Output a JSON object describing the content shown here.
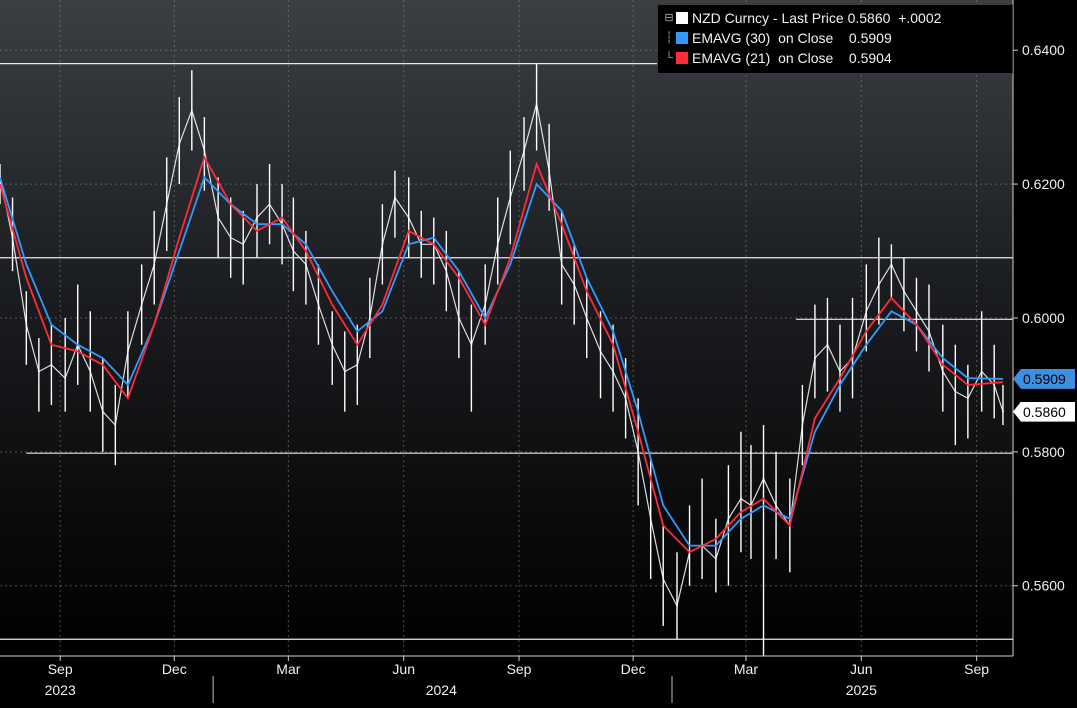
{
  "legend": {
    "row1": {
      "name": "NZD Curncy - Last Price",
      "value": "0.5860",
      "change": "+.0002",
      "color": "#ffffff"
    },
    "row2": {
      "name": "EMAVG (30)  on Close",
      "value": "0.5909",
      "color": "#3399ff"
    },
    "row3": {
      "name": "EMAVG (21)  on Close",
      "value": "0.5904",
      "color": "#ff2a3a"
    },
    "tree_icon": "collapse-tree-icon"
  },
  "price_tags": {
    "ema30": {
      "label": "0.5909",
      "bg": "#3d8fe0",
      "fg": "#000000"
    },
    "last": {
      "label": "0.5860",
      "bg": "#ffffff",
      "fg": "#000000"
    }
  },
  "chart_data": {
    "type": "line",
    "title": "",
    "xlabel": "",
    "ylabel": "",
    "y_tick_labels": [
      "0.6400",
      "0.6200",
      "0.6000",
      "0.5800",
      "0.5600"
    ],
    "y_ticks": [
      0.64,
      0.62,
      0.6,
      0.58,
      0.56
    ],
    "ylim": [
      0.5495,
      0.6475
    ],
    "x_month_labels": [
      "Sep",
      "Dec",
      "Mar",
      "Jun",
      "Sep",
      "Dec",
      "Mar",
      "Jun",
      "Sep"
    ],
    "x_month_positions": [
      "2023-09-01",
      "2023-12-01",
      "2024-03-01",
      "2024-06-01",
      "2024-09-01",
      "2024-12-01",
      "2025-03-01",
      "2025-06-01",
      "2025-09-01"
    ],
    "x_year_labels": [
      "2023",
      "2024",
      "2025"
    ],
    "x_year_centers": [
      "2023-09-01",
      "2024-07-01",
      "2025-06-01"
    ],
    "x_year_breaks": [
      "2024-01-01",
      "2025-01-01"
    ],
    "xlim": [
      "2023-07-15",
      "2025-09-30"
    ],
    "grid": true,
    "legend_position": "top-right",
    "reference_lines": [
      {
        "y": 0.638,
        "from": "2023-07-15",
        "to": "2025-09-30"
      },
      {
        "y": 0.609,
        "from": "2023-07-15",
        "to": "2025-09-30"
      },
      {
        "y": 0.5998,
        "from": "2025-04-10",
        "to": "2025-09-30"
      },
      {
        "y": 0.5798,
        "from": "2023-08-05",
        "to": "2025-09-30"
      },
      {
        "y": 0.552,
        "from": "2023-07-15",
        "to": "2025-09-30"
      }
    ],
    "series": [
      {
        "name": "NZD Curncy - Last Price",
        "color": "#ffffff",
        "style": "hilo",
        "x": [
          "2023-07-15",
          "2023-07-25",
          "2023-08-05",
          "2023-08-15",
          "2023-08-25",
          "2023-09-05",
          "2023-09-15",
          "2023-09-25",
          "2023-10-05",
          "2023-10-15",
          "2023-10-25",
          "2023-11-05",
          "2023-11-15",
          "2023-11-25",
          "2023-12-05",
          "2023-12-15",
          "2023-12-25",
          "2024-01-05",
          "2024-01-15",
          "2024-01-25",
          "2024-02-05",
          "2024-02-15",
          "2024-02-25",
          "2024-03-05",
          "2024-03-15",
          "2024-03-25",
          "2024-04-05",
          "2024-04-15",
          "2024-04-25",
          "2024-05-05",
          "2024-05-15",
          "2024-05-25",
          "2024-06-05",
          "2024-06-15",
          "2024-06-25",
          "2024-07-05",
          "2024-07-15",
          "2024-07-25",
          "2024-08-05",
          "2024-08-15",
          "2024-08-25",
          "2024-09-05",
          "2024-09-15",
          "2024-09-25",
          "2024-10-05",
          "2024-10-15",
          "2024-10-25",
          "2024-11-05",
          "2024-11-15",
          "2024-11-25",
          "2024-12-05",
          "2024-12-15",
          "2024-12-25",
          "2025-01-05",
          "2025-01-15",
          "2025-01-25",
          "2025-02-05",
          "2025-02-15",
          "2025-02-25",
          "2025-03-05",
          "2025-03-15",
          "2025-03-25",
          "2025-04-05",
          "2025-04-15",
          "2025-04-25",
          "2025-05-05",
          "2025-05-15",
          "2025-05-25",
          "2025-06-05",
          "2025-06-15",
          "2025-06-25",
          "2025-07-05",
          "2025-07-15",
          "2025-07-25",
          "2025-08-05",
          "2025-08-15",
          "2025-08-25",
          "2025-09-05",
          "2025-09-15",
          "2025-09-22"
        ],
        "values": [
          0.621,
          0.612,
          0.599,
          0.592,
          0.593,
          0.591,
          0.596,
          0.592,
          0.586,
          0.584,
          0.595,
          0.602,
          0.608,
          0.617,
          0.626,
          0.631,
          0.625,
          0.615,
          0.612,
          0.611,
          0.615,
          0.617,
          0.614,
          0.61,
          0.608,
          0.602,
          0.596,
          0.592,
          0.593,
          0.6,
          0.611,
          0.618,
          0.615,
          0.611,
          0.611,
          0.607,
          0.6,
          0.596,
          0.602,
          0.611,
          0.618,
          0.625,
          0.632,
          0.622,
          0.608,
          0.605,
          0.6,
          0.595,
          0.592,
          0.588,
          0.58,
          0.57,
          0.561,
          0.557,
          0.565,
          0.566,
          0.564,
          0.57,
          0.573,
          0.572,
          0.576,
          0.572,
          0.569,
          0.584,
          0.594,
          0.596,
          0.592,
          0.594,
          0.601,
          0.605,
          0.608,
          0.604,
          0.601,
          0.598,
          0.592,
          0.589,
          0.588,
          0.592,
          0.59,
          0.586
        ],
        "highs": [
          0.623,
          0.618,
          0.604,
          0.597,
          0.599,
          0.6,
          0.605,
          0.601,
          0.594,
          0.59,
          0.601,
          0.608,
          0.616,
          0.624,
          0.633,
          0.637,
          0.63,
          0.621,
          0.618,
          0.616,
          0.62,
          0.623,
          0.62,
          0.618,
          0.613,
          0.608,
          0.601,
          0.598,
          0.599,
          0.606,
          0.617,
          0.622,
          0.621,
          0.616,
          0.615,
          0.613,
          0.607,
          0.602,
          0.608,
          0.618,
          0.625,
          0.63,
          0.638,
          0.629,
          0.616,
          0.611,
          0.606,
          0.601,
          0.599,
          0.594,
          0.588,
          0.579,
          0.569,
          0.565,
          0.572,
          0.576,
          0.57,
          0.578,
          0.583,
          0.581,
          0.584,
          0.58,
          0.576,
          0.59,
          0.602,
          0.603,
          0.599,
          0.603,
          0.608,
          0.612,
          0.611,
          0.609,
          0.606,
          0.605,
          0.599,
          0.596,
          0.593,
          0.601,
          0.596,
          0.59
        ],
        "lows": [
          0.617,
          0.607,
          0.593,
          0.586,
          0.587,
          0.586,
          0.59,
          0.586,
          0.58,
          0.578,
          0.588,
          0.596,
          0.602,
          0.61,
          0.62,
          0.625,
          0.619,
          0.609,
          0.606,
          0.605,
          0.609,
          0.611,
          0.608,
          0.604,
          0.602,
          0.596,
          0.59,
          0.586,
          0.587,
          0.594,
          0.605,
          0.612,
          0.609,
          0.606,
          0.605,
          0.601,
          0.594,
          0.586,
          0.596,
          0.605,
          0.611,
          0.619,
          0.625,
          0.616,
          0.602,
          0.599,
          0.594,
          0.588,
          0.586,
          0.582,
          0.572,
          0.561,
          0.554,
          0.552,
          0.56,
          0.561,
          0.559,
          0.56,
          0.565,
          0.564,
          0.549,
          0.564,
          0.562,
          0.578,
          0.588,
          0.589,
          0.586,
          0.588,
          0.595,
          0.599,
          0.603,
          0.598,
          0.595,
          0.592,
          0.586,
          0.581,
          0.582,
          0.586,
          0.585,
          0.584
        ]
      },
      {
        "name": "EMAVG (30)  on Close",
        "color": "#3399ff",
        "style": "line",
        "x": [
          "2023-07-15",
          "2023-08-05",
          "2023-08-25",
          "2023-09-15",
          "2023-10-05",
          "2023-10-25",
          "2023-11-15",
          "2023-12-05",
          "2023-12-25",
          "2024-01-15",
          "2024-02-05",
          "2024-02-25",
          "2024-03-15",
          "2024-04-05",
          "2024-04-25",
          "2024-05-15",
          "2024-06-05",
          "2024-06-25",
          "2024-07-15",
          "2024-08-05",
          "2024-08-25",
          "2024-09-15",
          "2024-10-05",
          "2024-10-25",
          "2024-11-15",
          "2024-12-05",
          "2024-12-25",
          "2025-01-15",
          "2025-02-05",
          "2025-02-25",
          "2025-03-15",
          "2025-04-05",
          "2025-04-25",
          "2025-05-15",
          "2025-06-05",
          "2025-06-25",
          "2025-07-15",
          "2025-08-05",
          "2025-08-25",
          "2025-09-22"
        ],
        "values": [
          0.621,
          0.608,
          0.599,
          0.596,
          0.594,
          0.59,
          0.599,
          0.61,
          0.621,
          0.617,
          0.614,
          0.614,
          0.611,
          0.604,
          0.598,
          0.601,
          0.611,
          0.612,
          0.607,
          0.6,
          0.608,
          0.62,
          0.616,
          0.606,
          0.598,
          0.586,
          0.572,
          0.566,
          0.566,
          0.57,
          0.572,
          0.57,
          0.583,
          0.59,
          0.596,
          0.601,
          0.599,
          0.594,
          0.591,
          0.5909
        ]
      },
      {
        "name": "EMAVG (21)  on Close",
        "color": "#ff2a3a",
        "style": "line",
        "x": [
          "2023-07-15",
          "2023-08-05",
          "2023-08-25",
          "2023-09-15",
          "2023-10-05",
          "2023-10-25",
          "2023-11-15",
          "2023-12-05",
          "2023-12-25",
          "2024-01-15",
          "2024-02-05",
          "2024-02-25",
          "2024-03-15",
          "2024-04-05",
          "2024-04-25",
          "2024-05-15",
          "2024-06-05",
          "2024-06-25",
          "2024-07-15",
          "2024-08-05",
          "2024-08-25",
          "2024-09-15",
          "2024-10-05",
          "2024-10-25",
          "2024-11-15",
          "2024-12-05",
          "2024-12-25",
          "2025-01-15",
          "2025-02-05",
          "2025-02-25",
          "2025-03-15",
          "2025-04-05",
          "2025-04-25",
          "2025-05-15",
          "2025-06-05",
          "2025-06-25",
          "2025-07-15",
          "2025-08-05",
          "2025-08-25",
          "2025-09-22"
        ],
        "values": [
          0.62,
          0.606,
          0.596,
          0.595,
          0.593,
          0.588,
          0.599,
          0.612,
          0.624,
          0.617,
          0.613,
          0.615,
          0.61,
          0.602,
          0.596,
          0.602,
          0.613,
          0.611,
          0.606,
          0.599,
          0.609,
          0.623,
          0.614,
          0.604,
          0.596,
          0.583,
          0.569,
          0.565,
          0.567,
          0.571,
          0.573,
          0.569,
          0.585,
          0.591,
          0.598,
          0.603,
          0.599,
          0.593,
          0.59,
          0.5904
        ]
      }
    ]
  }
}
